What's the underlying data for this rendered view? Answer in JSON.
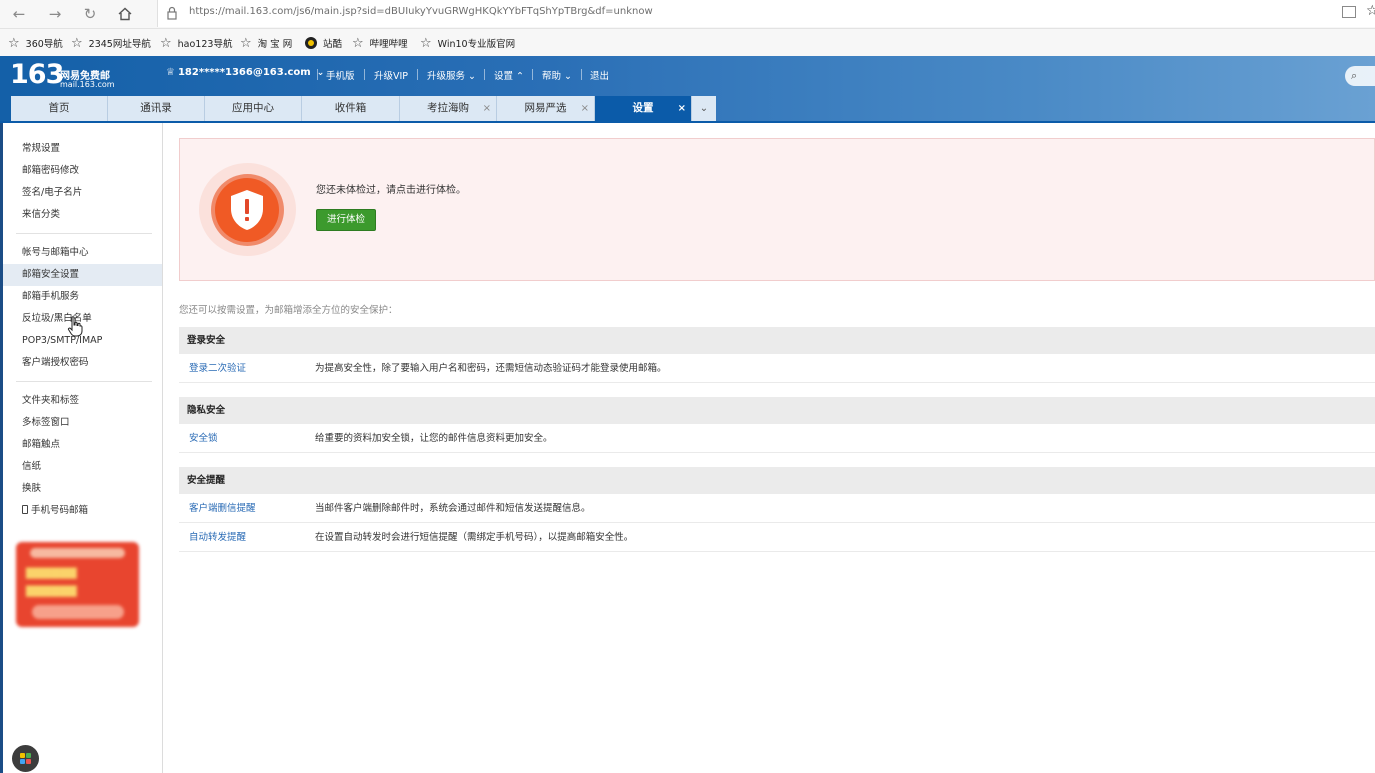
{
  "browser": {
    "url": "https://mail.163.com/js6/main.jsp?sid=dBUIukyYvuGRWgHKQkYYbFTqShYpTBrg&df=unknow",
    "bookmarks": [
      "360导航",
      "2345网址导航",
      "hao123导航",
      "淘 宝 网",
      "站酷",
      "哔哩哔哩",
      "Win10专业版官网"
    ]
  },
  "header": {
    "logo_number": "163",
    "logo_title": "网易免费邮",
    "logo_domain": "mail.163.com",
    "account": "182*****1366@163.com",
    "links": [
      "手机版",
      "升级VIP",
      "升级服务",
      "设置",
      "帮助",
      "退出"
    ]
  },
  "tabs": [
    {
      "label": "首页"
    },
    {
      "label": "通讯录"
    },
    {
      "label": "应用中心"
    },
    {
      "label": "收件箱"
    },
    {
      "label": "考拉海购"
    },
    {
      "label": "网易严选"
    },
    {
      "label": "设置"
    }
  ],
  "sidebar": {
    "group1": [
      "常规设置",
      "邮箱密码修改",
      "签名/电子名片",
      "来信分类"
    ],
    "group2": [
      "帐号与邮箱中心",
      "邮箱安全设置",
      "邮箱手机服务",
      "反垃圾/黑白名单",
      "POP3/SMTP/IMAP",
      "客户端授权密码"
    ],
    "group3": [
      "文件夹和标签",
      "多标签窗口",
      "邮箱触点",
      "信纸",
      "换肤",
      "手机号码邮箱"
    ],
    "active": "邮箱安全设置"
  },
  "checkup": {
    "message": "您还未体检过，请点击进行体检。",
    "button": "进行体检"
  },
  "intro": "您还可以按需设置，为邮箱增添全方位的安全保护：",
  "sections": [
    {
      "title": "登录安全",
      "rows": [
        {
          "link": "登录二次验证",
          "desc": "为提高安全性，除了要输入用户名和密码，还需短信动态验证码才能登录使用邮箱。"
        }
      ]
    },
    {
      "title": "隐私安全",
      "rows": [
        {
          "link": "安全锁",
          "desc": "给重要的资料加安全锁，让您的邮件信息资料更加安全。"
        }
      ]
    },
    {
      "title": "安全提醒",
      "rows": [
        {
          "link": "客户端删信提醒",
          "desc": "当邮件客户端删除邮件时，系统会通过邮件和短信发送提醒信息。"
        },
        {
          "link": "自动转发提醒",
          "desc": "在设置自动转发时会进行短信提醒（需绑定手机号码），以提高邮箱安全性。"
        }
      ]
    }
  ],
  "colors": {
    "header_blue": "#1460a8",
    "active_tab": "#0b5ba9",
    "link_blue": "#2a6bb5",
    "checkup_button": "#3c9a2d",
    "shield_orange": "#f05a25"
  }
}
